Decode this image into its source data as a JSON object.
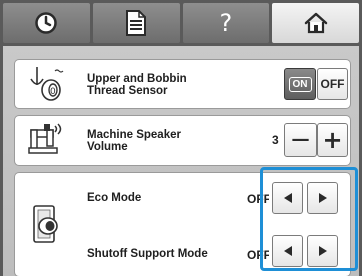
{
  "tabs": [
    {
      "icon": "clock-icon"
    },
    {
      "icon": "document-icon"
    },
    {
      "icon": "help-icon",
      "label": "?"
    },
    {
      "icon": "home-icon"
    }
  ],
  "settings": {
    "thread_sensor": {
      "label_line1": "Upper and Bobbin",
      "label_line2": "Thread Sensor",
      "on_label": "ON",
      "off_label": "OFF",
      "icon": "thread-spool-icon"
    },
    "speaker_volume": {
      "label_line1": "Machine Speaker",
      "label_line2": "Volume",
      "value": "3",
      "minus_label": "−",
      "plus_label": "+",
      "icon": "sewing-machine-speaker-icon"
    },
    "eco_mode": {
      "label": "Eco Mode",
      "value": "OFF",
      "icon": "eco-display-icon"
    },
    "shutoff_support": {
      "label": "Shutoff Support Mode",
      "value": "OFF"
    }
  },
  "colors": {
    "highlight": "#1e8fd6",
    "panel": "#c4c4c4",
    "frame": "#5a5a5a"
  }
}
